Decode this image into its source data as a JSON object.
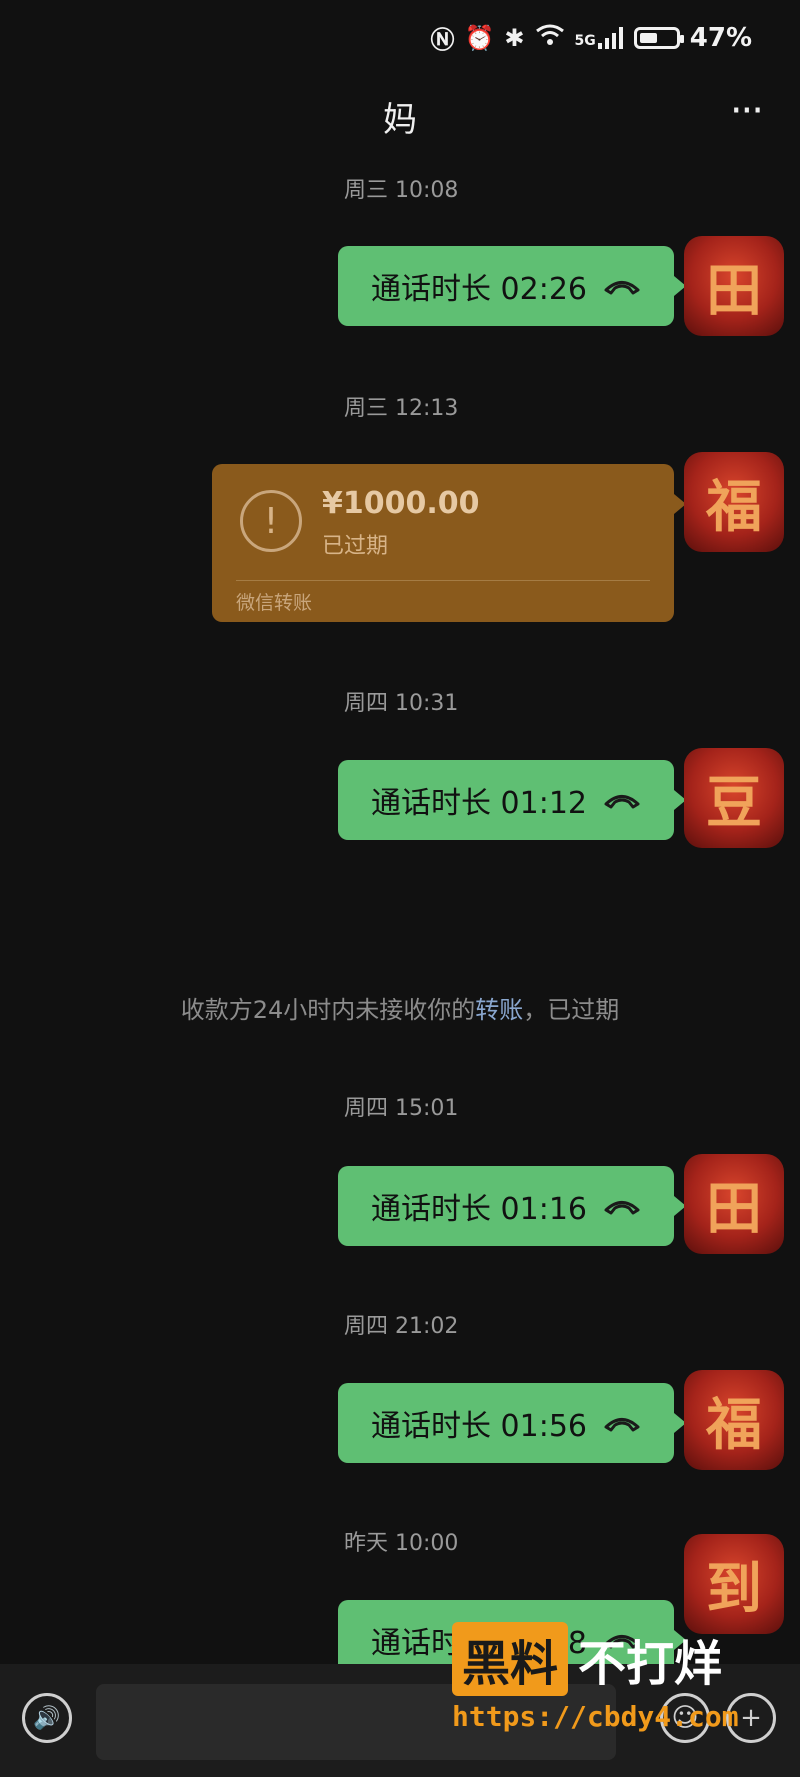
{
  "status_bar": {
    "battery_text": "47%",
    "icons": [
      "nfc-icon",
      "alarm-icon",
      "bluetooth-icon",
      "wifi-icon",
      "5g-signal-icon",
      "battery-icon"
    ],
    "network": "5G"
  },
  "header": {
    "title": "妈",
    "more": "···"
  },
  "messages": [
    {
      "time": "周三 10:08",
      "type": "call",
      "text": "通话时长 02:26",
      "avatar_char": "田"
    },
    {
      "time": "周三 12:13",
      "type": "transfer",
      "amount": "¥1000.00",
      "status": "已过期",
      "brand": "微信转账",
      "avatar_char": "福"
    },
    {
      "time": "周四 10:31",
      "type": "call",
      "text": "通话时长 01:12",
      "avatar_char": "豆"
    },
    {
      "time": "周四 15:01",
      "type": "call",
      "text": "通话时长 01:16",
      "avatar_char": "田"
    },
    {
      "time": "周四 21:02",
      "type": "call",
      "text": "通话时长 01:56",
      "avatar_char": "福"
    },
    {
      "time": "昨天 10:00",
      "type": "call",
      "text": "通话时长 02:48",
      "avatar_char": "到"
    }
  ],
  "system_message": {
    "prefix": "收款方24小时内未接收你的",
    "link": "转账",
    "suffix": "，已过期"
  },
  "watermark": {
    "box": "黑料",
    "text": "不打烊",
    "url": "https://cbdy4.com"
  },
  "colors": {
    "bubble": "#5fbf73",
    "transfer_card": "#8a5a1c",
    "background": "#111111",
    "link": "#8aa7cf"
  }
}
